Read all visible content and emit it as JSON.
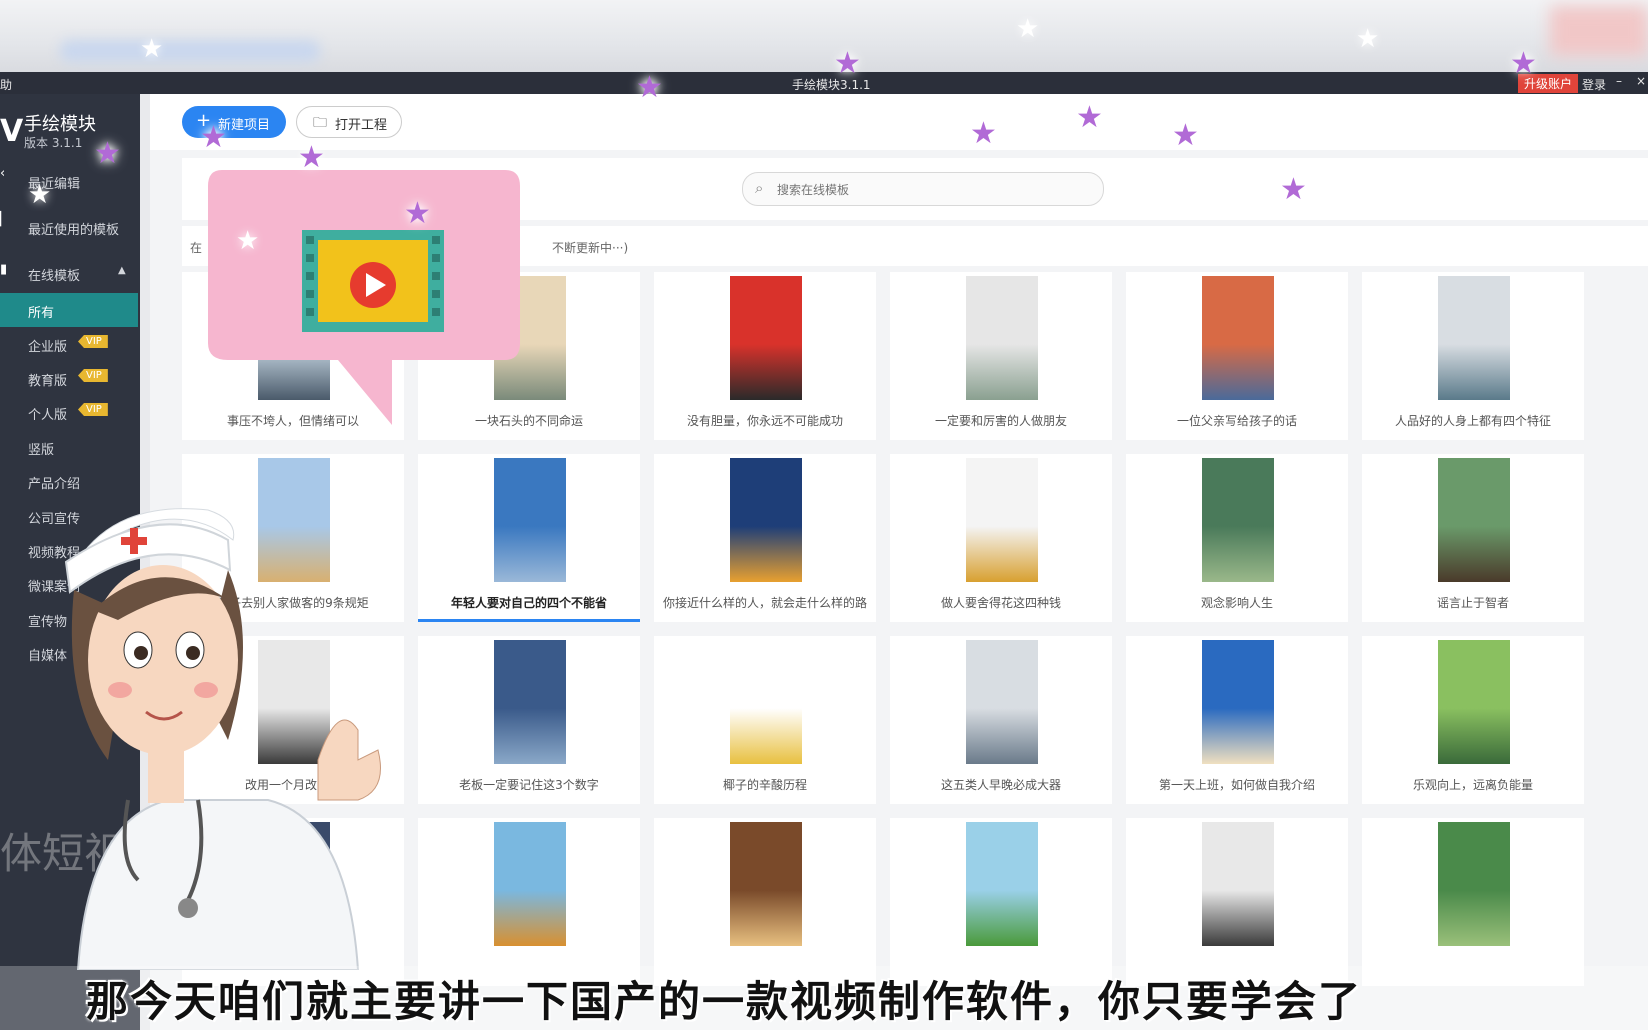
{
  "window": {
    "menu_help": "助",
    "title": "手绘模块3.1.1",
    "upgrade_label": "升级账户",
    "login_label": "登录",
    "minimize_label": "–",
    "close_label": "×"
  },
  "sidebar": {
    "logo_mark": "V",
    "app_name": "手绘模块",
    "version": "版本 3.1.1",
    "items": [
      {
        "label": "最近编辑"
      },
      {
        "label": "最近使用的模板"
      },
      {
        "label": "在线模板"
      },
      {
        "label": "所有"
      },
      {
        "label": "企业版",
        "badge": "VIP"
      },
      {
        "label": "教育版",
        "badge": "VIP"
      },
      {
        "label": "个人版",
        "badge": "VIP"
      },
      {
        "label": "竖版"
      },
      {
        "label": "产品介绍"
      },
      {
        "label": "公司宣传"
      },
      {
        "label": "视频教程"
      },
      {
        "label": "微课案例"
      },
      {
        "label": "宣传物"
      },
      {
        "label": "自媒体"
      }
    ]
  },
  "toolbar": {
    "new_project": "新建项目",
    "open_project": "打开工程"
  },
  "search": {
    "placeholder": "搜索在线模板"
  },
  "info_bar": {
    "left_text": "在",
    "right_text": "不断更新中···)"
  },
  "templates": [
    "事压不垮人，但情绪可以",
    "一块石头的不同命运",
    "没有胆量，你永远不可能成功",
    "一定要和厉害的人做朋友",
    "一位父亲写给孩子的话",
    "人品好的人身上都有四个特征",
    "孩子去别人家做客的9条规矩",
    "年轻人要对自己的四个不能省",
    "你接近什么样的人，就会走什么样的路",
    "做人要舍得花这四种钱",
    "观念影响人生",
    "谣言止于智者",
    "改用一个月改自己",
    "老板一定要记住这3个数字",
    "椰子的辛酸历程",
    "这五类人早晚必成大器",
    "第一天上班，如何做自我介绍",
    "乐观向上，远离负能量",
    "",
    "",
    "",
    "",
    "",
    ""
  ],
  "overlay": {
    "subtitle": "那今天咱们就主要讲一下国产的一款视频制作软件，你只要学会了",
    "watermark": "体短视"
  },
  "colors": {
    "accent": "#2b85f2",
    "sidebar_bg": "#2f3440",
    "sidebar_active": "#1f8a8a",
    "vip": "#e8b730",
    "upgrade": "#e0443a",
    "bubble": "#f6b6cf",
    "star": "#b16ad6"
  }
}
